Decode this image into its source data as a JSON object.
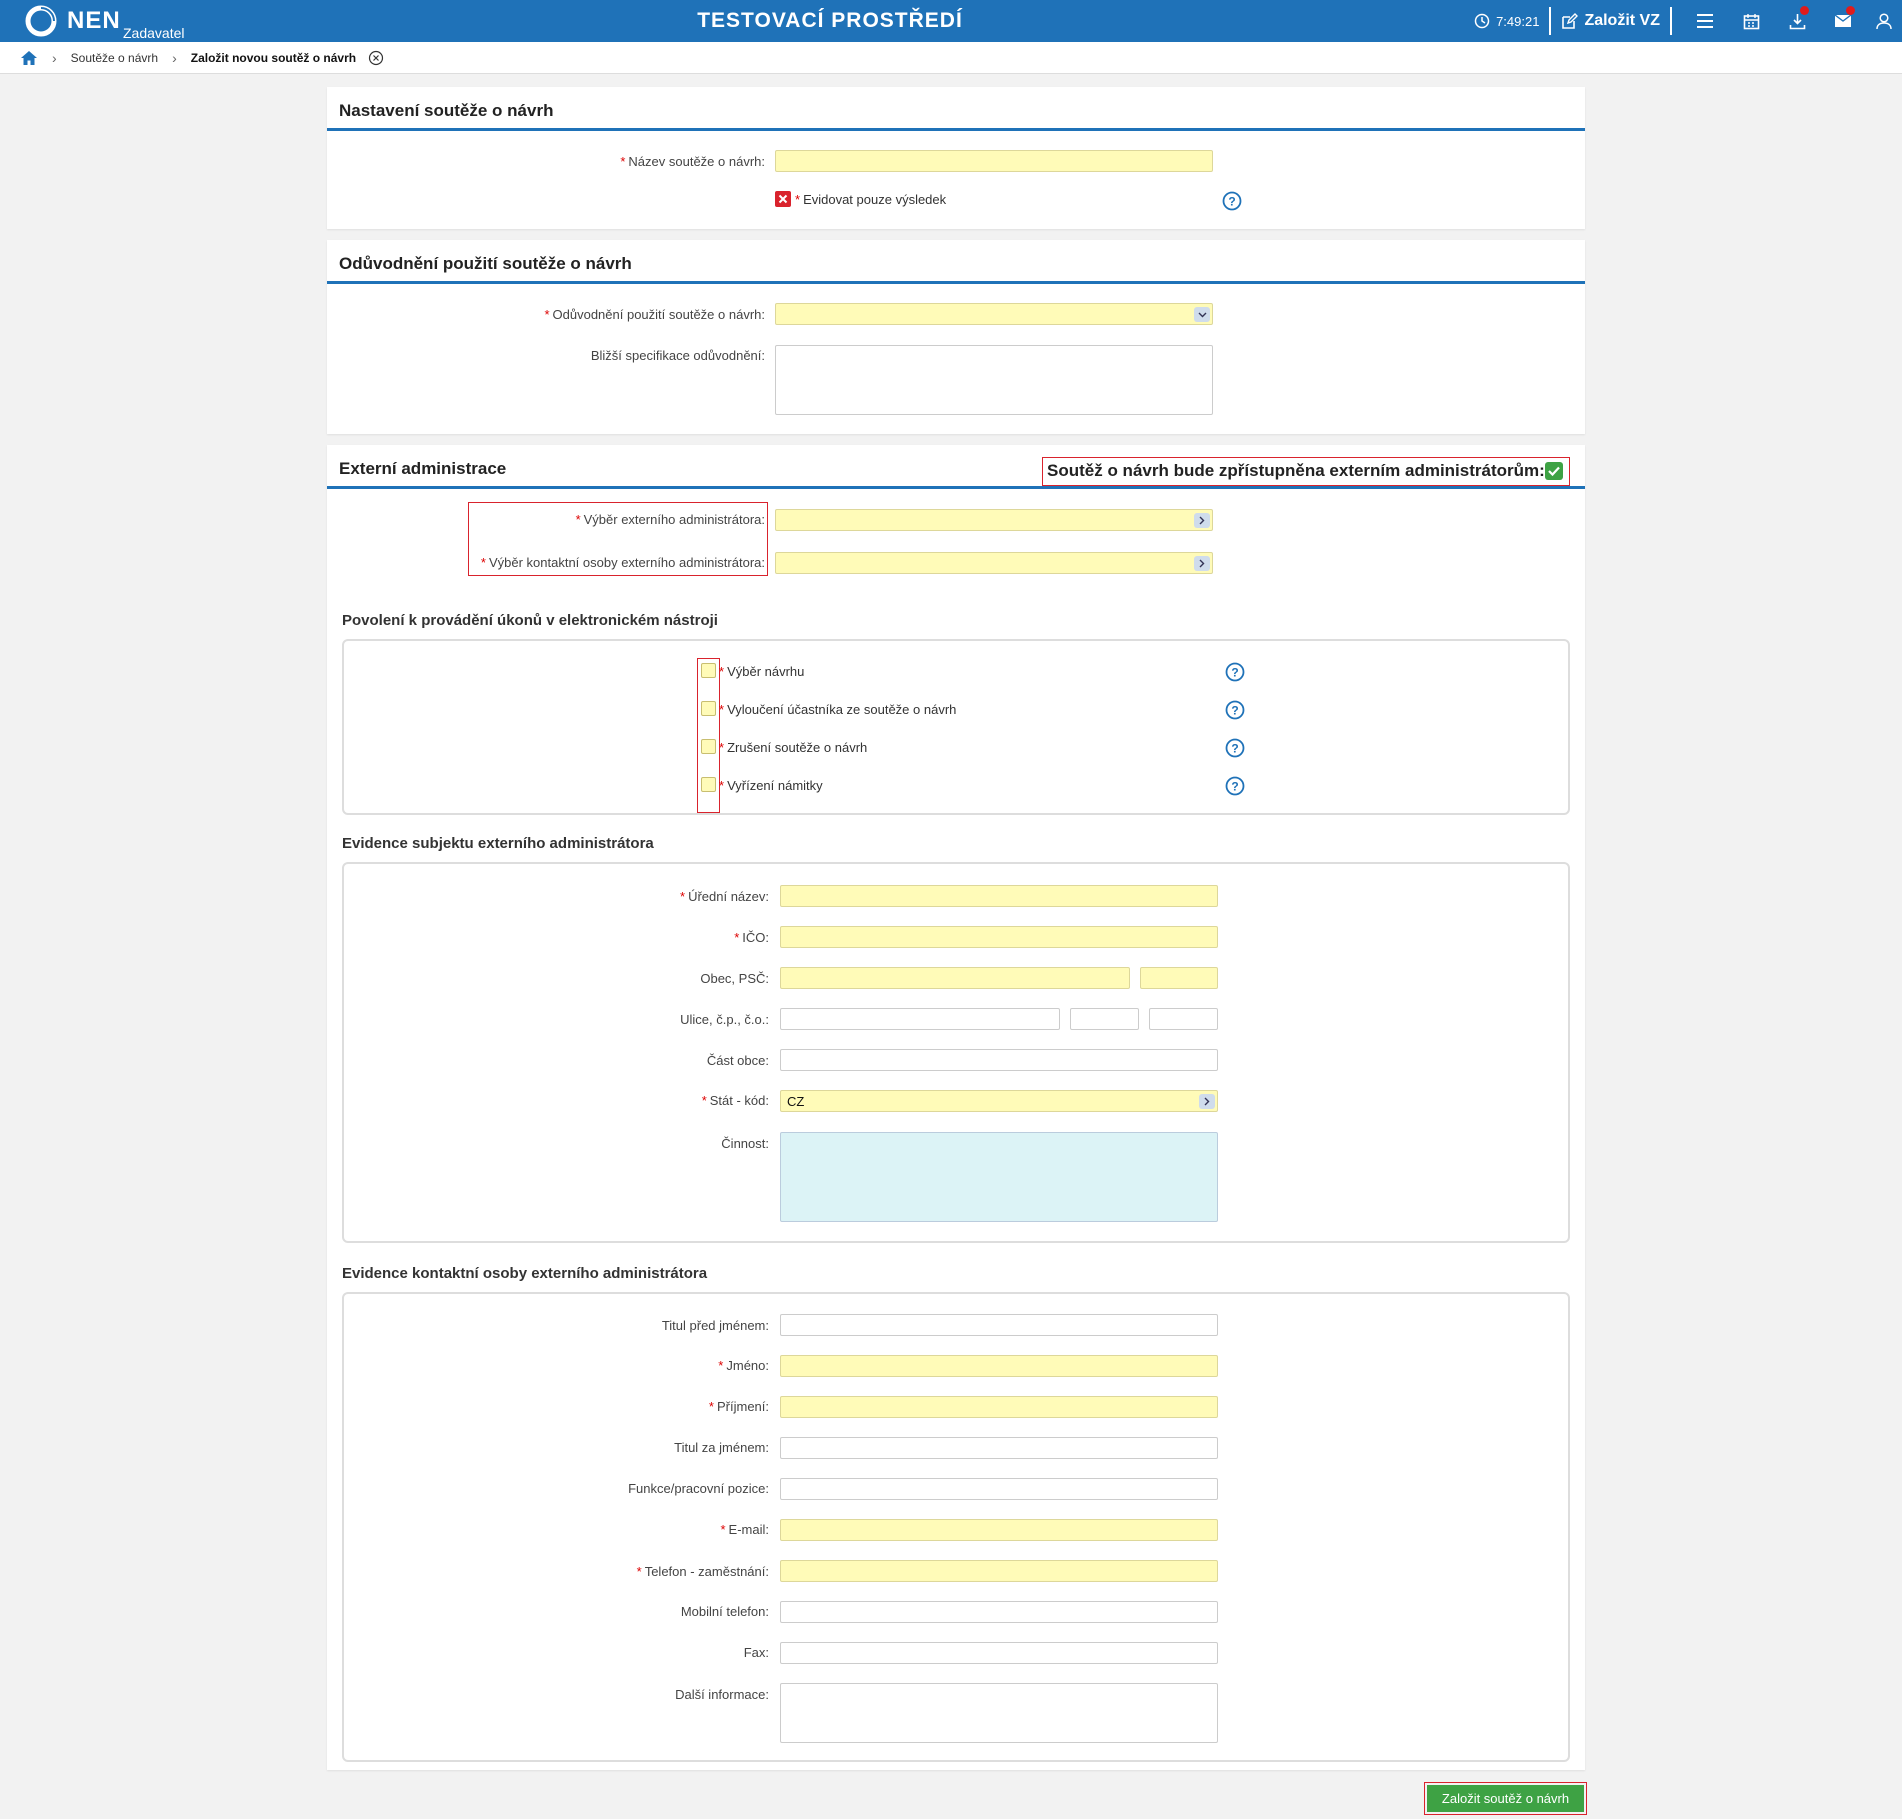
{
  "header": {
    "logo_text": "NEN",
    "logo_sub": "Zadavatel",
    "env_title": "TESTOVACÍ PROSTŘEDÍ",
    "time": "7:49:21",
    "create_vz": "Založit VZ"
  },
  "breadcrumb": {
    "item1": "Soutěže o návrh",
    "current": "Založit novou soutěž o návrh"
  },
  "panel1": {
    "title": "Nastavení soutěže o návrh",
    "name_label": "Název soutěže o návrh:",
    "name_value": "",
    "result_only_label": "Evidovat pouze výsledek"
  },
  "panel2": {
    "title": "Odůvodnění použití soutěže o návrh",
    "reason_label": "Odůvodnění použití soutěže o návrh:",
    "reason_value": "",
    "spec_label": "Bližší specifikace odůvodnění:"
  },
  "panel3": {
    "title": "Externí administrace",
    "access_label": "Soutěž o návrh bude zpřístupněna externím administrátorům:",
    "admin_label": "Výběr externího administrátora:",
    "contact_label": "Výběr kontaktní osoby externího administrátora:",
    "permissions_title": "Povolení k provádění úkonů v elektronickém nástroji",
    "permissions": [
      "Výběr návrhu",
      "Vyloučení účastníka ze soutěže o návrh",
      "Zrušení soutěže o návrh",
      "Vyřízení námitky"
    ],
    "subject_title": "Evidence subjektu externího administrátora",
    "subject": {
      "official_name": "Úřední název:",
      "ico": "IČO:",
      "city_zip": "Obec, PSČ:",
      "street": "Ulice, č.p., č.o.:",
      "district": "Část obce:",
      "country": "Stát - kód:",
      "country_value": "CZ",
      "activity": "Činnost:"
    },
    "contact_title": "Evidence kontaktní osoby externího administrátora",
    "contact": {
      "title_before": "Titul před jménem:",
      "first_name": "Jméno:",
      "last_name": "Příjmení:",
      "title_after": "Titul za jménem:",
      "position": "Funkce/pracovní pozice:",
      "email": "E-mail:",
      "phone_work": "Telefon - zaměstnání:",
      "mobile": "Mobilní telefon:",
      "fax": "Fax:",
      "other": "Další informace:"
    }
  },
  "submit_label": "Založit soutěž o návrh"
}
